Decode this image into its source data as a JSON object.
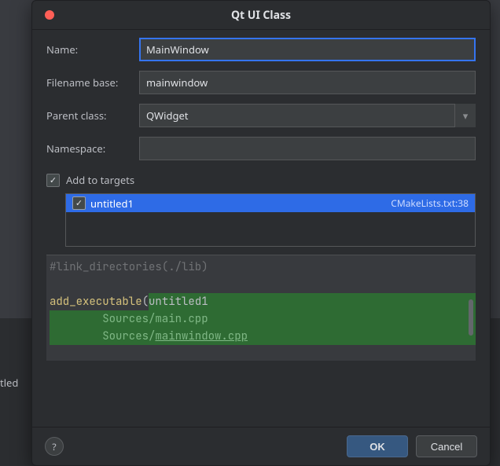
{
  "behind_text": "tled",
  "dialog": {
    "title": "Qt UI Class",
    "fields": {
      "name_label": "Name:",
      "name_value": "MainWindow",
      "filename_label": "Filename base:",
      "filename_value": "mainwindow",
      "parent_label": "Parent class:",
      "parent_value": "QWidget",
      "namespace_label": "Namespace:",
      "namespace_value": ""
    },
    "targets": {
      "checkbox_label": "Add to targets",
      "checkbox_checked": true,
      "items": [
        {
          "checked": true,
          "name": "untitled1",
          "meta": "CMakeLists.txt:38"
        }
      ]
    },
    "preview": {
      "line1_comment": "#link_directories(./lib)",
      "line3_call": "add_executable",
      "line3_open": "(",
      "line3_arg": "untitled1",
      "line4_indent": "        ",
      "line4_str": "Sources/main.cpp",
      "line5_indent": "        ",
      "line5_str_a": "Sources/",
      "line5_str_b": "mainwindow.cpp"
    },
    "footer": {
      "help": "?",
      "ok": "OK",
      "cancel": "Cancel"
    }
  }
}
